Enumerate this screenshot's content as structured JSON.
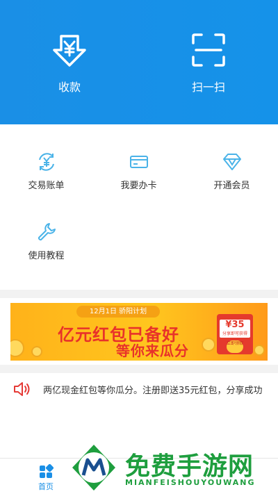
{
  "hero": {
    "receive_label": "收款",
    "scan_label": "扫一扫",
    "background_color": "#1a8fe6"
  },
  "grid": {
    "items": [
      {
        "label": "交易账单",
        "icon": "exchange-yen-icon"
      },
      {
        "label": "我要办卡",
        "icon": "card-icon"
      },
      {
        "label": "开通会员",
        "icon": "diamond-icon"
      },
      {
        "label": "使用教程",
        "icon": "wrench-icon"
      }
    ],
    "icon_color": "#4ab3e8"
  },
  "banner": {
    "date_plan": "12月1日  骄阳计划",
    "headline": "亿元红包已备好",
    "subline": "等你来瓜分",
    "amount": "¥35",
    "amount_note": "分享即可获得",
    "claim_button": "立即领取"
  },
  "notice": {
    "icon": "speaker-icon",
    "text": "两亿现金红包等你瓜分。注册即送35元红包，分享成功"
  },
  "tabbar": {
    "home_label": "首页",
    "active_color": "#1a8fe6"
  },
  "watermark": {
    "title": "免费手游网",
    "subtitle": "MIANFEISHOUYOUWANG"
  }
}
